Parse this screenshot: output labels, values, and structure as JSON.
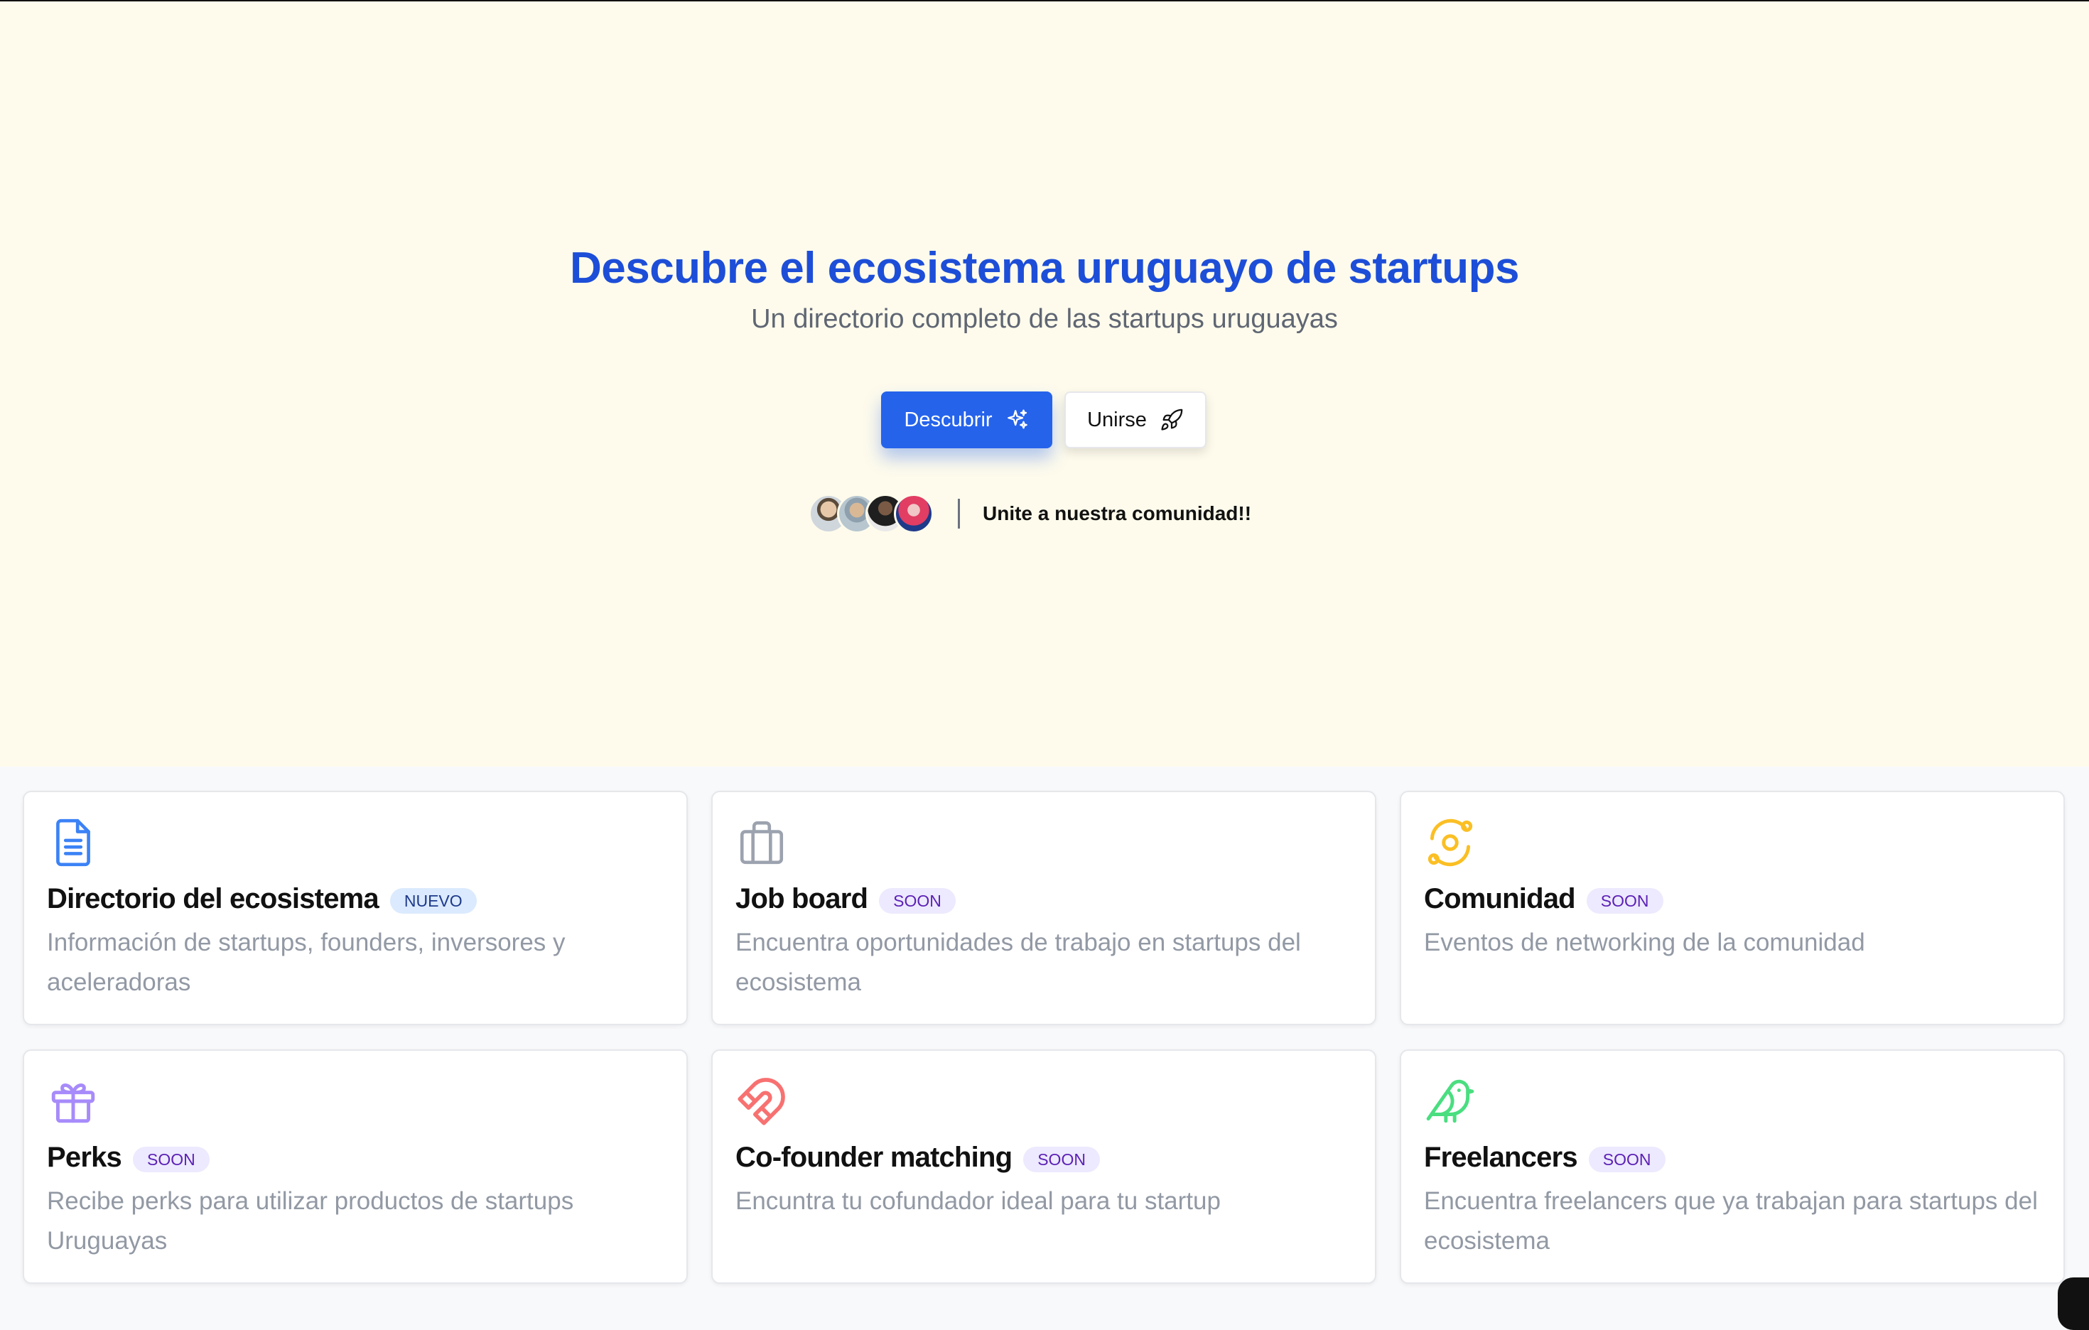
{
  "hero": {
    "title": "Descubre el ecosistema uruguayo de startups",
    "subtitle": "Un directorio completo de las startups uruguayas",
    "primary_button": {
      "label": "Descubrir",
      "icon": "sparkles-icon"
    },
    "secondary_button": {
      "label": "Unirse",
      "icon": "rocket-icon"
    },
    "community_text": "Unite a nuestra comunidad!!"
  },
  "colors": {
    "hero_background": "#fefbec",
    "title_blue": "#1d4ed8",
    "primary_button": "#2563eb",
    "badge_new_bg": "#dbeafe",
    "badge_new_text": "#1e3a8a",
    "badge_soon_bg": "#ede9fe",
    "badge_soon_text": "#5b21b6"
  },
  "features": [
    {
      "title": "Directorio del ecosistema",
      "badge": "NUEVO",
      "badge_type": "new",
      "description": "Información de startups, founders, inversores y aceleradoras",
      "icon": "document-icon",
      "icon_color": "#3b82f6"
    },
    {
      "title": "Job board",
      "badge": "SOON",
      "badge_type": "soon",
      "description": "Encuentra oportunidades de trabajo en startups del ecosistema",
      "icon": "briefcase-icon",
      "icon_color": "#9ca3af"
    },
    {
      "title": "Comunidad",
      "badge": "SOON",
      "badge_type": "soon",
      "description": "Eventos de networking de la comunidad",
      "icon": "orbit-icon",
      "icon_color": "#fbbf24"
    },
    {
      "title": "Perks",
      "badge": "SOON",
      "badge_type": "soon",
      "description": "Recibe perks para utilizar productos de startups Uruguayas",
      "icon": "gift-icon",
      "icon_color": "#a78bfa"
    },
    {
      "title": "Co-founder matching",
      "badge": "SOON",
      "badge_type": "soon",
      "description": "Encuntra tu cofundador ideal para tu startup",
      "icon": "magnet-icon",
      "icon_color": "#f87171"
    },
    {
      "title": "Freelancers",
      "badge": "SOON",
      "badge_type": "soon",
      "description": "Encuentra freelancers que ya trabajan para startups del ecosistema",
      "icon": "bird-icon",
      "icon_color": "#4ade80"
    }
  ]
}
